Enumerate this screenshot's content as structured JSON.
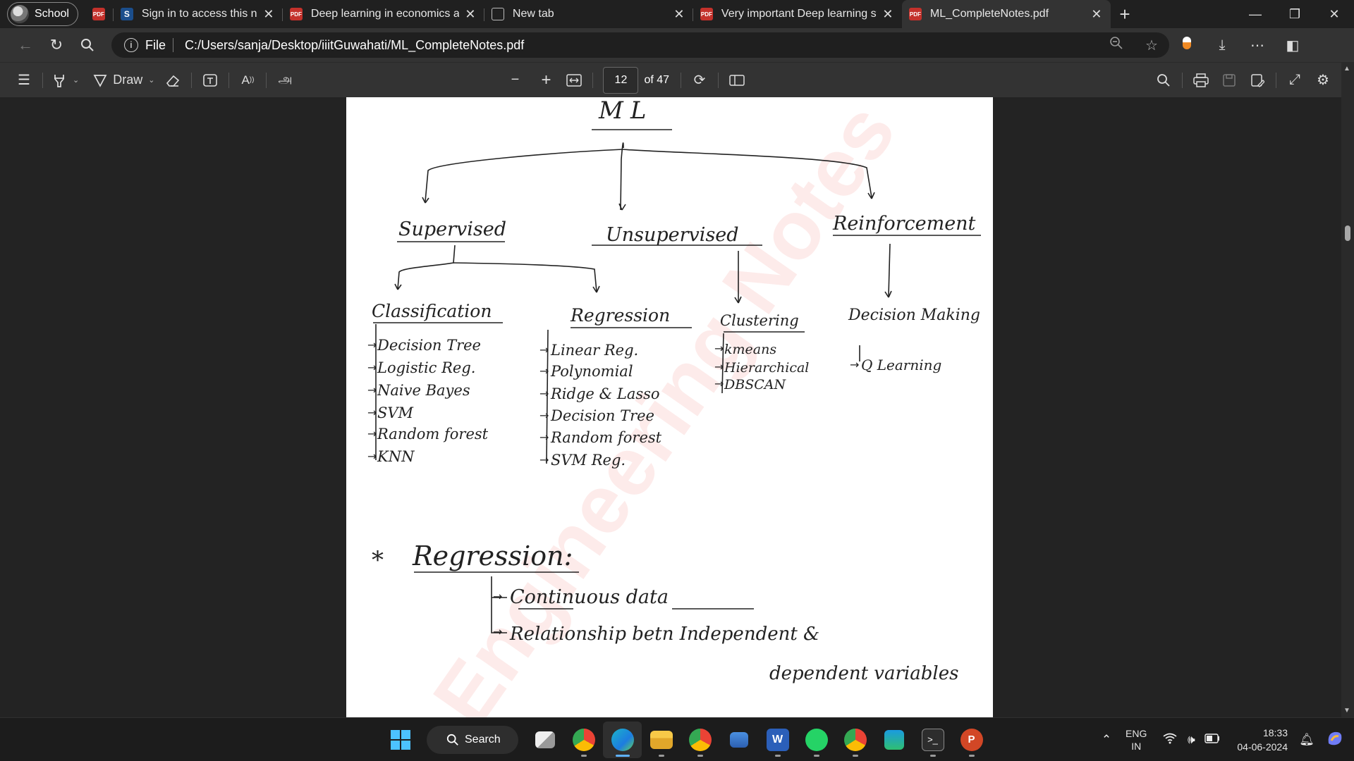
{
  "tabs": {
    "profile_label": "School",
    "items": [
      {
        "title": "",
        "icon": "pdf-icon",
        "active": false
      },
      {
        "title": "Sign in to access this network",
        "icon": "s-icon",
        "active": false
      },
      {
        "title": "Deep learning in economics a sy",
        "icon": "pdf-icon",
        "active": false
      },
      {
        "title": "New tab",
        "icon": "newtab-icon",
        "active": false
      },
      {
        "title": "Very important Deep learning st",
        "icon": "pdf-icon",
        "active": false
      },
      {
        "title": "ML_CompleteNotes.pdf",
        "icon": "pdf-icon",
        "active": true
      }
    ],
    "close_glyph": "✕",
    "new_tab_glyph": "+"
  },
  "address": {
    "info_glyph": "i",
    "scheme_label": "File",
    "url": "C:/Users/sanja/Desktop/iiitGuwahati/ML_CompleteNotes.pdf"
  },
  "pdf_toolbar": {
    "draw_label": "Draw",
    "page_number": "12",
    "page_total": "of 47",
    "zoom_out_glyph": "−",
    "zoom_in_glyph": "+"
  },
  "document": {
    "title": "ML",
    "branches": [
      "Supervised",
      "Unsupervised",
      "Reinforcement"
    ],
    "sub_branches": [
      "Classification",
      "Regression",
      "Clustering",
      "Decision Making"
    ],
    "classification_items": [
      "Decision Tree",
      "Logistic Reg.",
      "Naive Bayes",
      "SVM",
      "Random forest",
      "KNN"
    ],
    "regression_items": [
      "Linear Reg.",
      "Polynomial",
      "Ridge & Lasso",
      "Decision Tree",
      "Random forest",
      "SVM Reg."
    ],
    "clustering_items": [
      "kmeans",
      "Hierarchical",
      "DBSCAN"
    ],
    "decision_items": [
      "Q Learning"
    ],
    "section_star": "*",
    "section_heading": "Regression:",
    "section_points": [
      "Continuous data",
      "Relationship betn Independent &",
      "dependent variables"
    ],
    "watermark": "Engineering Notes"
  },
  "taskbar": {
    "search_label": "Search",
    "language_top": "ENG",
    "language_bottom": "IN",
    "time": "18:33",
    "date": "04-06-2024"
  },
  "colors": {
    "pdf_red": "#c4312b",
    "accent_blue": "#5fb2ff",
    "watermark_red": "#eb3c32"
  }
}
